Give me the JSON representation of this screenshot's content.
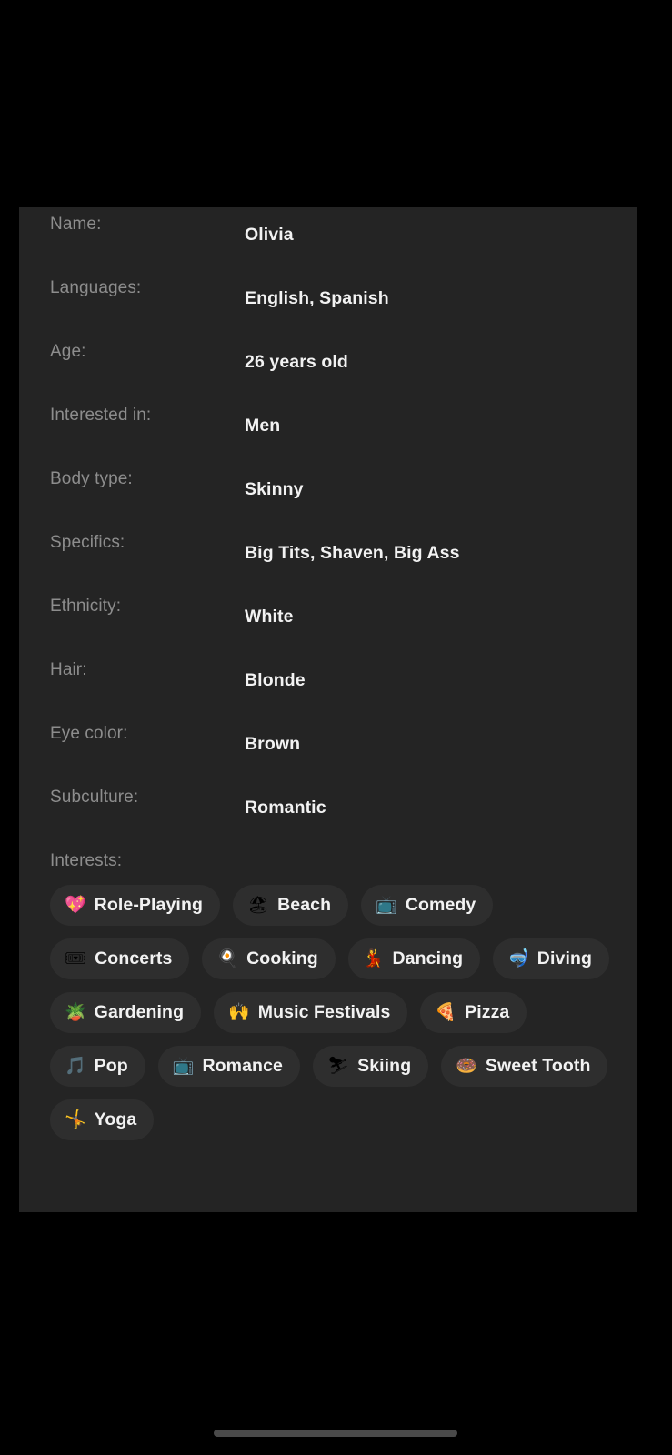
{
  "profile": {
    "details": [
      {
        "label": "Name:",
        "value": "Olivia"
      },
      {
        "label": "Languages:",
        "value": "English, Spanish"
      },
      {
        "label": "Age:",
        "value": "26 years old"
      },
      {
        "label": "Interested in:",
        "value": "Men"
      },
      {
        "label": "Body type:",
        "value": "Skinny"
      },
      {
        "label": "Specifics:",
        "value": "Big Tits, Shaven, Big Ass"
      },
      {
        "label": "Ethnicity:",
        "value": "White"
      },
      {
        "label": "Hair:",
        "value": "Blonde"
      },
      {
        "label": "Eye color:",
        "value": "Brown"
      },
      {
        "label": "Subculture:",
        "value": "Romantic"
      }
    ],
    "interests_label": "Interests:",
    "interests": [
      {
        "label": "Role-Playing",
        "emoji": "💖",
        "icon_name": "sparkling-heart-icon"
      },
      {
        "label": "Beach",
        "emoji": "🏖",
        "icon_name": "beach-with-umbrella-icon"
      },
      {
        "label": "Comedy",
        "emoji": "📺",
        "icon_name": "television-icon"
      },
      {
        "label": "Concerts",
        "emoji": "🎟",
        "icon_name": "admission-tickets-icon"
      },
      {
        "label": "Cooking",
        "emoji": "🍳",
        "icon_name": "cooking-egg-icon"
      },
      {
        "label": "Dancing",
        "emoji": "💃",
        "icon_name": "woman-dancing-icon"
      },
      {
        "label": "Diving",
        "emoji": "🤿",
        "icon_name": "diving-mask-icon"
      },
      {
        "label": "Gardening",
        "emoji": "🪴",
        "icon_name": "potted-plant-icon"
      },
      {
        "label": "Music Festivals",
        "emoji": "🙌",
        "icon_name": "raising-hands-icon"
      },
      {
        "label": "Pizza",
        "emoji": "🍕",
        "icon_name": "pizza-slice-icon"
      },
      {
        "label": "Pop",
        "emoji": "🎵",
        "icon_name": "musical-note-icon"
      },
      {
        "label": "Romance",
        "emoji": "📺",
        "icon_name": "television-icon"
      },
      {
        "label": "Skiing",
        "emoji": "⛷",
        "icon_name": "skier-icon"
      },
      {
        "label": "Sweet Tooth",
        "emoji": "🍩",
        "icon_name": "doughnut-icon"
      },
      {
        "label": "Yoga",
        "emoji": "🤸",
        "icon_name": "person-cartwheeling-icon"
      }
    ]
  },
  "colors": {
    "page_background": "#000000",
    "panel_background": "#242424",
    "chip_background": "#2e2e2e",
    "label_text": "#8d8d8d",
    "value_text": "#f2f2f2",
    "scrollbar_thumb": "#a8a8a8",
    "home_indicator": "#4a4a4a"
  }
}
